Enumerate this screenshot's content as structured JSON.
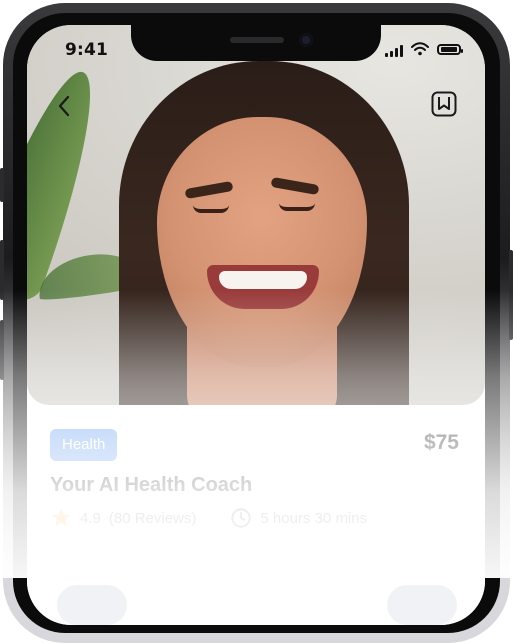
{
  "status_bar": {
    "time": "9:41"
  },
  "course": {
    "tag": "Health",
    "price": "$75",
    "title": "Your AI Health Coach",
    "rating": "4.9",
    "reviews": "(80 Reviews)",
    "duration": "5 hours 30 mins"
  },
  "colors": {
    "tag_bg": "#6aa1f2",
    "star": "#f6b73c"
  },
  "icons": {
    "back": "chevron-left-icon",
    "save": "bookmark-icon",
    "rating": "star-icon",
    "duration": "clock-icon"
  }
}
